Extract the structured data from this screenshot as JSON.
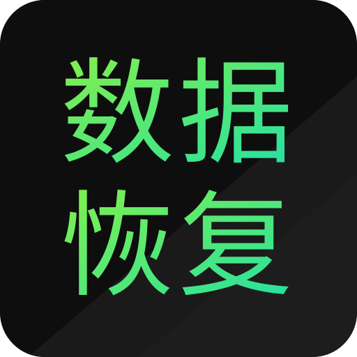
{
  "app_icon": {
    "name": "数据恢复 app icon",
    "line1": "数据",
    "line2": "恢复"
  },
  "colors": {
    "background": "#0e0e0e",
    "background_diagonal": "#1b1b1b",
    "text_gradient_start": "#86f04a",
    "text_gradient_end": "#1fe0a6"
  }
}
